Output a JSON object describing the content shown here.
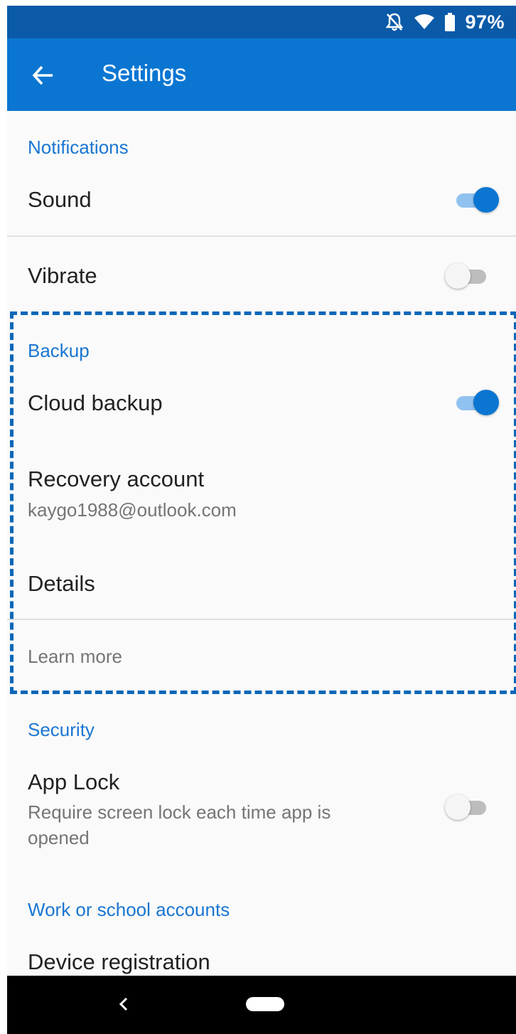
{
  "status_bar": {
    "battery_percent": "97%",
    "icons": [
      "notifications-off-icon",
      "wifi-icon",
      "battery-icon"
    ]
  },
  "app_bar": {
    "title": "Settings",
    "back_icon": "arrow-back-icon"
  },
  "sections": {
    "notifications": {
      "header": "Notifications",
      "sound": {
        "label": "Sound",
        "enabled": true
      },
      "vibrate": {
        "label": "Vibrate",
        "enabled": false
      }
    },
    "backup": {
      "header": "Backup",
      "cloud_backup": {
        "label": "Cloud backup",
        "enabled": true
      },
      "recovery_account": {
        "label": "Recovery account",
        "value": "kaygo1988@outlook.com"
      },
      "details": {
        "label": "Details"
      },
      "learn_more": {
        "label": "Learn more"
      }
    },
    "security": {
      "header": "Security",
      "app_lock": {
        "label": "App Lock",
        "description_line1": "Require screen lock each time app is",
        "description_line2": "opened",
        "enabled": false
      }
    },
    "work_school": {
      "header": "Work or school accounts",
      "device_registration": {
        "label": "Device registration"
      }
    }
  },
  "colors": {
    "status_bar": "#0a5aa8",
    "app_bar": "#0b76d2",
    "accent": "#1976d2",
    "highlight_border": "#0b67b8"
  },
  "nav_bar": {
    "icons": [
      "nav-back-icon",
      "nav-home-pill"
    ]
  }
}
